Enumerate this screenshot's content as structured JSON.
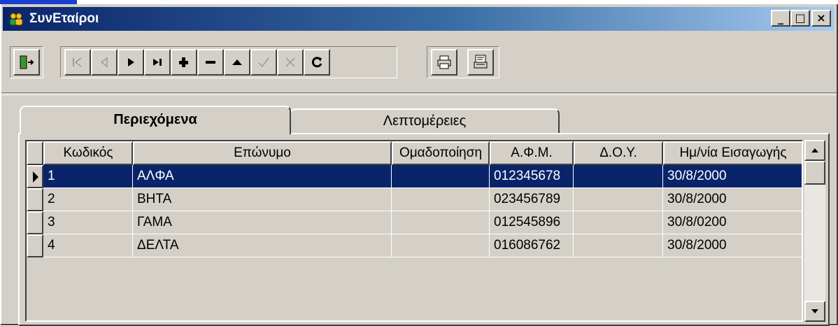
{
  "window": {
    "title": "ΣυνΕταίροι",
    "icon": "group-icon",
    "controls": [
      "minimize-icon",
      "maximize-icon",
      "close-icon"
    ]
  },
  "toolbar": {
    "buttons": [
      {
        "name": "exit-button",
        "icon": "exit-door-icon",
        "enabled": true
      },
      {
        "name": "first-record-button",
        "icon": "first-icon",
        "enabled": false
      },
      {
        "name": "prior-record-button",
        "icon": "prior-icon",
        "enabled": false
      },
      {
        "name": "next-record-button",
        "icon": "next-icon",
        "enabled": true
      },
      {
        "name": "last-record-button",
        "icon": "last-icon",
        "enabled": true
      },
      {
        "name": "insert-record-button",
        "icon": "plus-icon",
        "enabled": true
      },
      {
        "name": "delete-record-button",
        "icon": "minus-icon",
        "enabled": true
      },
      {
        "name": "edit-record-button",
        "icon": "up-triangle-icon",
        "enabled": true
      },
      {
        "name": "post-record-button",
        "icon": "check-icon",
        "enabled": false
      },
      {
        "name": "cancel-record-button",
        "icon": "x-icon",
        "enabled": false
      },
      {
        "name": "refresh-button",
        "icon": "refresh-icon",
        "enabled": true
      },
      {
        "name": "print-button",
        "icon": "printer-icon",
        "enabled": true
      },
      {
        "name": "print-preview-button",
        "icon": "print-preview-icon",
        "enabled": true
      }
    ]
  },
  "tabs": [
    {
      "label": "Περιεχόμενα",
      "active": true
    },
    {
      "label": "Λεπτομέρειες",
      "active": false
    }
  ],
  "grid": {
    "columns": [
      "Κωδικός",
      "Επώνυμο",
      "Ομαδοποίηση",
      "Α.Φ.Μ.",
      "Δ.Ο.Υ.",
      "Ημ/νία Εισαγωγής"
    ],
    "rows": [
      [
        "1",
        "ΑΛΦΑ",
        "",
        "012345678",
        "",
        "30/8/2000"
      ],
      [
        "2",
        "ΒΗΤΑ",
        "",
        "023456789",
        "",
        "30/8/2000"
      ],
      [
        "3",
        "ΓΑΜΑ",
        "",
        "012545896",
        "",
        "30/8/0200"
      ],
      [
        "4",
        "ΔΕΛΤΑ",
        "",
        "016086762",
        "",
        "30/8/2000"
      ]
    ],
    "selected_row": 0
  },
  "colors": {
    "title_start": "#0a246a",
    "title_end": "#a6caf0",
    "selection": "#0a246a",
    "face": "#d4d0c8"
  }
}
